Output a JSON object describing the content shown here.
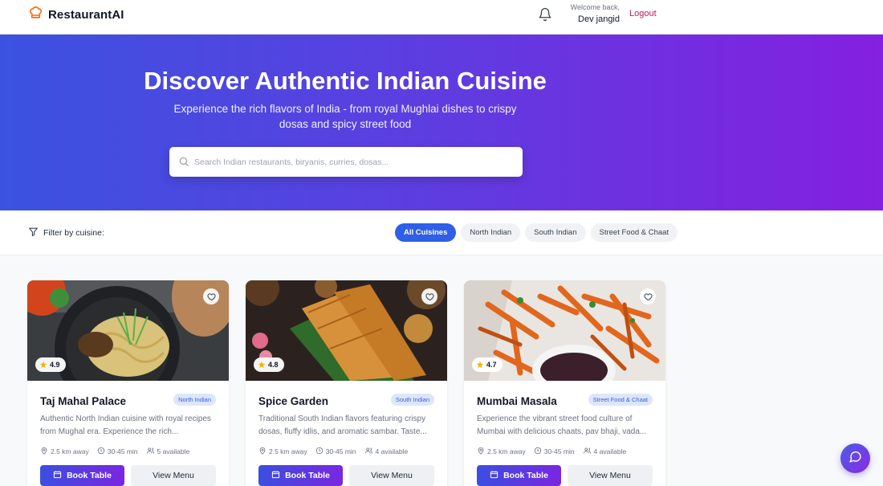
{
  "header": {
    "brand": "RestaurantAI",
    "welcome": "Welcome back,",
    "user_name": "Dev jangid",
    "logout": "Logout"
  },
  "hero": {
    "title": "Discover Authentic Indian Cuisine",
    "subtitle": "Experience the rich flavors of India - from royal Mughlai dishes to crispy dosas and spicy street food",
    "search_placeholder": "Search Indian restaurants, biryanis, curries, dosas..."
  },
  "filter": {
    "label": "Filter by cuisine:",
    "chips": [
      "All Cuisines",
      "North Indian",
      "South Indian",
      "Street Food & Chaat"
    ],
    "active": "All Cuisines"
  },
  "cards": [
    {
      "name": "Taj Mahal Palace",
      "cuisine": "North Indian",
      "rating": "4.9",
      "description": "Authentic North Indian cuisine with royal recipes from Mughal era. Experience the rich...",
      "distance": "2.5 km away",
      "time": "30-45 min",
      "available": "5 available",
      "book": "Book Table",
      "menu": "View Menu"
    },
    {
      "name": "Spice Garden",
      "cuisine": "South Indian",
      "rating": "4.8",
      "description": "Traditional South Indian flavors featuring crispy dosas, fluffy idlis, and aromatic sambar. Taste...",
      "distance": "2.5 km away",
      "time": "30-45 min",
      "available": "4 available",
      "book": "Book Table",
      "menu": "View Menu"
    },
    {
      "name": "Mumbai Masala",
      "cuisine": "Street Food & Chaat",
      "rating": "4.7",
      "description": "Experience the vibrant street food culture of Mumbai with delicious chaats, pav bhaji, vada...",
      "distance": "2.5 km away",
      "time": "30-45 min",
      "available": "4 available",
      "book": "Book Table",
      "menu": "View Menu"
    }
  ],
  "colors": {
    "accent": "#2f5fe6",
    "brand_icon": "#f97316",
    "logout": "#c2185b",
    "hero_start": "#3b52e0",
    "hero_end": "#8420e0"
  },
  "icons": {
    "brand": "chef-hat-icon",
    "notifications": "bell-icon",
    "search": "search-icon",
    "filter": "funnel-icon",
    "favorite": "heart-icon",
    "rating": "star-icon",
    "distance": "map-pin-icon",
    "time": "clock-icon",
    "available": "users-icon",
    "book": "calendar-icon",
    "chat": "chat-bubble-icon"
  }
}
